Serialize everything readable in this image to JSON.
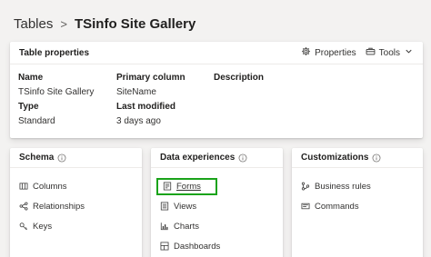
{
  "breadcrumb": {
    "root": "Tables",
    "separator": ">",
    "current": "TSinfo Site Gallery"
  },
  "table_properties": {
    "title": "Table properties",
    "actions": [
      {
        "label": "Properties",
        "icon": "gear-icon"
      },
      {
        "label": "Tools",
        "icon": "toolbox-icon"
      }
    ],
    "fields": {
      "name_label": "Name",
      "name_value": "TSinfo Site Gallery",
      "primary_column_label": "Primary column",
      "primary_column_value": "SiteName",
      "description_label": "Description",
      "type_label": "Type",
      "type_value": "Standard",
      "last_modified_label": "Last modified",
      "last_modified_value": "3 days ago"
    }
  },
  "sections": {
    "schema": {
      "title": "Schema",
      "items": [
        {
          "label": "Columns",
          "icon": "columns-icon"
        },
        {
          "label": "Relationships",
          "icon": "relationships-icon"
        },
        {
          "label": "Keys",
          "icon": "key-icon"
        }
      ]
    },
    "data_experiences": {
      "title": "Data experiences",
      "items": [
        {
          "label": "Forms",
          "icon": "form-icon"
        },
        {
          "label": "Views",
          "icon": "views-icon"
        },
        {
          "label": "Charts",
          "icon": "chart-icon"
        },
        {
          "label": "Dashboards",
          "icon": "dashboard-icon"
        }
      ]
    },
    "customizations": {
      "title": "Customizations",
      "items": [
        {
          "label": "Business rules",
          "icon": "business-rules-icon"
        },
        {
          "label": "Commands",
          "icon": "commands-icon"
        }
      ]
    }
  },
  "colors": {
    "highlight_border": "#1aa31a",
    "background": "#f3f2f1",
    "card": "#ffffff"
  }
}
